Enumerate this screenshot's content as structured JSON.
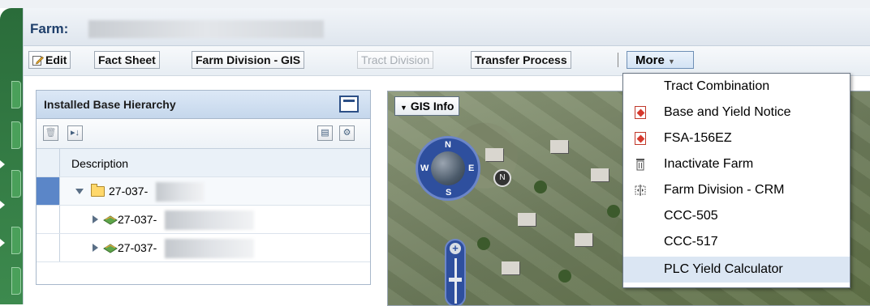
{
  "header": {
    "farm_label": "Farm:"
  },
  "toolbar": {
    "edit": "Edit",
    "fact_sheet": "Fact Sheet",
    "farm_division_gis": "Farm Division - GIS",
    "tract_division": "Tract Division",
    "transfer_process": "Transfer Process",
    "more": "More"
  },
  "hierarchy": {
    "title": "Installed Base Hierarchy",
    "column": "Description",
    "rows": [
      {
        "label": "27-037-",
        "level": 0,
        "icon": "folder-icon",
        "expanded": true
      },
      {
        "label": "27-037-",
        "level": 1,
        "icon": "land-tract-icon",
        "expanded": false
      },
      {
        "label": "27-037-",
        "level": 1,
        "icon": "land-tract-icon",
        "expanded": false
      }
    ]
  },
  "gis": {
    "button": "GIS Info",
    "compass": {
      "n": "N",
      "e": "E",
      "s": "S",
      "w": "W"
    },
    "north": "N",
    "zoom_plus": "+"
  },
  "menu": {
    "items": [
      {
        "label": "Tract Combination",
        "icon": ""
      },
      {
        "label": "Base and Yield Notice",
        "icon": "pdf-icon"
      },
      {
        "label": "FSA-156EZ",
        "icon": "pdf-icon"
      },
      {
        "label": "Inactivate Farm",
        "icon": "trash-icon"
      },
      {
        "label": "Farm Division - CRM",
        "icon": "split-icon"
      },
      {
        "label": "CCC-505",
        "icon": ""
      },
      {
        "label": "CCC-517",
        "icon": ""
      },
      {
        "label": "PLC Yield Calculator",
        "icon": "",
        "highlighted": true
      }
    ]
  }
}
